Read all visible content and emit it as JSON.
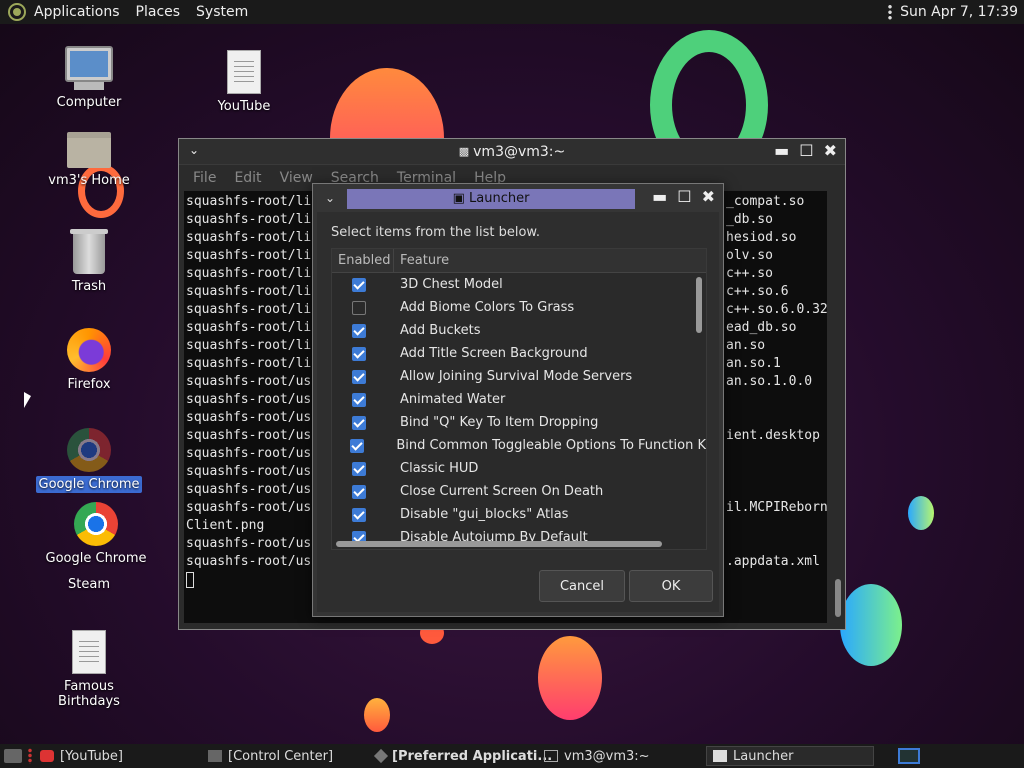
{
  "top_panel": {
    "menus": [
      "Applications",
      "Places",
      "System"
    ],
    "clock": "Sun Apr 7, 17:39"
  },
  "desktop_icons": [
    {
      "label": "Computer",
      "icon": "computer-icon"
    },
    {
      "label": "YouTube",
      "icon": "document-icon"
    },
    {
      "label": "vm3's Home",
      "icon": "home-folder-icon"
    },
    {
      "label": "Trash",
      "icon": "trash-icon"
    },
    {
      "label": "Firefox",
      "icon": "firefox-icon"
    },
    {
      "label": "Google Chrome",
      "icon": "chrome-icon",
      "selected": true
    },
    {
      "label": "Google Chrome",
      "icon": "chrome-icon"
    },
    {
      "label": "Steam",
      "icon": "steam-icon"
    },
    {
      "label": "Famous Birthdays",
      "icon": "document-icon"
    }
  ],
  "terminal": {
    "title": "vm3@vm3:~",
    "menus": [
      "File",
      "Edit",
      "View",
      "Search",
      "Terminal",
      "Help"
    ],
    "lines_left": [
      "squashfs-root/li",
      "squashfs-root/li",
      "squashfs-root/li",
      "squashfs-root/li",
      "squashfs-root/li",
      "squashfs-root/li",
      "squashfs-root/li",
      "squashfs-root/li",
      "squashfs-root/li",
      "squashfs-root/li",
      "squashfs-root/us",
      "squashfs-root/us",
      "squashfs-root/us",
      "squashfs-root/us",
      "squashfs-root/us",
      "squashfs-root/us",
      "squashfs-root/us",
      "squashfs-root/us",
      "Client.png",
      "squashfs-root/us",
      "squashfs-root/us"
    ],
    "lines_right": [
      "_compat.so",
      "_db.so",
      "hesiod.so",
      "olv.so",
      "c++.so",
      "c++.so.6",
      "c++.so.6.0.32",
      "ead_db.so",
      "an.so",
      "an.so.1",
      "an.so.1.0.0",
      "",
      "",
      "ient.desktop",
      "",
      "",
      "",
      "il.MCPIReborn",
      "",
      "",
      ".appdata.xml"
    ]
  },
  "launcher": {
    "title": "Launcher",
    "instruction": "Select items from the list below.",
    "columns": {
      "enabled": "Enabled",
      "feature": "Feature"
    },
    "items": [
      {
        "label": "3D Chest Model",
        "enabled": true
      },
      {
        "label": "Add Biome Colors To Grass",
        "enabled": false
      },
      {
        "label": "Add Buckets",
        "enabled": true
      },
      {
        "label": "Add Title Screen Background",
        "enabled": true
      },
      {
        "label": "Allow Joining Survival Mode Servers",
        "enabled": true
      },
      {
        "label": "Animated Water",
        "enabled": true
      },
      {
        "label": "Bind \"Q\" Key To Item Dropping",
        "enabled": true
      },
      {
        "label": "Bind Common Toggleable Options To Function K",
        "enabled": true
      },
      {
        "label": "Classic HUD",
        "enabled": true
      },
      {
        "label": "Close Current Screen On Death",
        "enabled": true
      },
      {
        "label": "Disable \"gui_blocks\" Atlas",
        "enabled": true
      },
      {
        "label": "Disable Autojump By Default",
        "enabled": true
      }
    ],
    "cancel_label": "Cancel",
    "ok_label": "OK"
  },
  "taskbar": {
    "tasks": [
      "[YouTube]",
      "[Control Center]",
      "[Preferred Applicati...",
      "vm3@vm3:~",
      "Launcher"
    ]
  },
  "colors": {
    "accent": "#3d7bd6",
    "title_highlight": "#7a76b8"
  }
}
